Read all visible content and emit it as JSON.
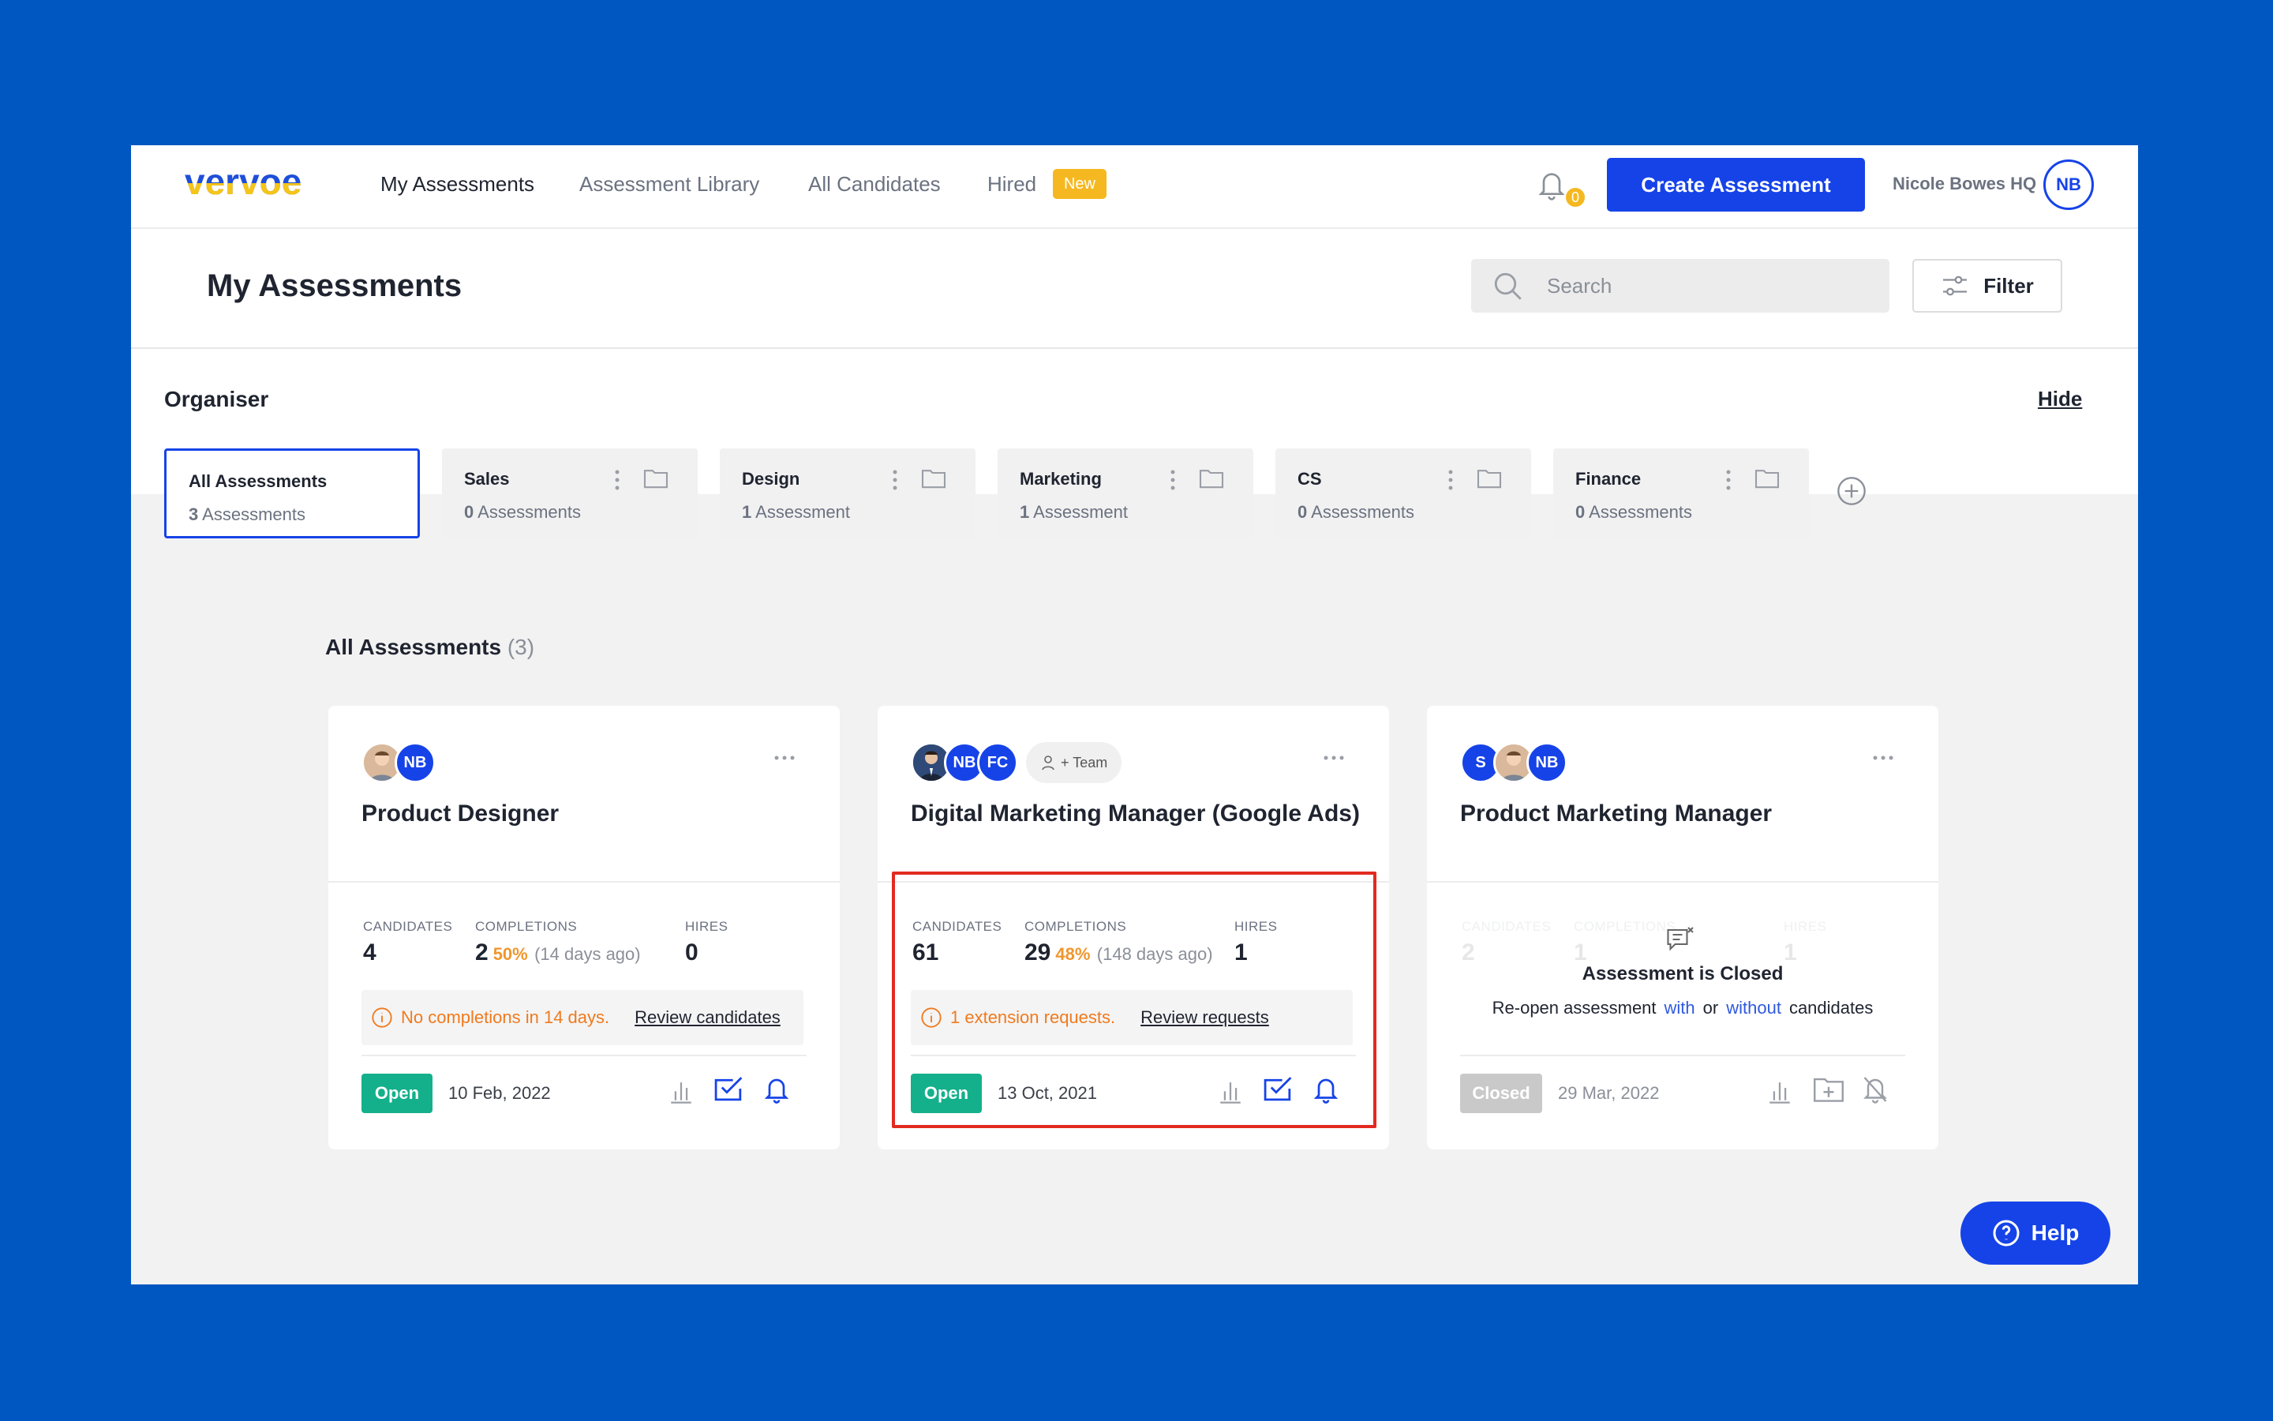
{
  "brand": {
    "logo_text": "vervoe",
    "primary": "#1643e8",
    "accent": "#f5b820",
    "background": "#0057c2"
  },
  "nav": {
    "items": [
      {
        "label": "My Assessments",
        "active": true
      },
      {
        "label": "Assessment Library",
        "active": false
      },
      {
        "label": "All Candidates",
        "active": false
      },
      {
        "label": "Hired",
        "active": false
      }
    ],
    "new_badge": "New",
    "notifications_count": "0",
    "create_button": "Create Assessment",
    "org_name": "Nicole Bowes HQ",
    "user_initials": "NB"
  },
  "header": {
    "title": "My Assessments",
    "search_placeholder": "Search",
    "filter_label": "Filter"
  },
  "organiser": {
    "title": "Organiser",
    "hide_label": "Hide",
    "folders": [
      {
        "name": "All Assessments",
        "count_num": "3",
        "count_label": "Assessments",
        "active": true
      },
      {
        "name": "Sales",
        "count_num": "0",
        "count_label": "Assessments"
      },
      {
        "name": "Design",
        "count_num": "1",
        "count_label": "Assessment"
      },
      {
        "name": "Marketing",
        "count_num": "1",
        "count_label": "Assessment"
      },
      {
        "name": "CS",
        "count_num": "0",
        "count_label": "Assessments"
      },
      {
        "name": "Finance",
        "count_num": "0",
        "count_label": "Assessments"
      }
    ]
  },
  "list": {
    "title": "All Assessments",
    "count": "(3)"
  },
  "labels": {
    "candidates": "CANDIDATES",
    "completions": "COMPLETIONS",
    "hires": "HIRES"
  },
  "cards": [
    {
      "title": "Product Designer",
      "avatars": [
        "NB"
      ],
      "candidates": "4",
      "completions": "2",
      "completion_pct": "50%",
      "completion_ago": "(14 days ago)",
      "hires": "0",
      "alert_text": "No completions in 14 days.",
      "alert_link": "Review candidates",
      "status": "Open",
      "date": "10 Feb, 2022"
    },
    {
      "title": "Digital Marketing Manager (Google Ads)",
      "avatars": [
        "NB",
        "FC"
      ],
      "team_label": "+ Team",
      "candidates": "61",
      "completions": "29",
      "completion_pct": "48%",
      "completion_ago": "(148 days ago)",
      "hires": "1",
      "alert_text": "1 extension requests.",
      "alert_link": "Review requests",
      "status": "Open",
      "date": "13 Oct, 2021"
    },
    {
      "title": "Product Marketing Manager",
      "avatars": [
        "S",
        "NB"
      ],
      "candidates": "2",
      "completions": "1",
      "hires": "1",
      "closed_title": "Assessment is Closed",
      "reopen_prefix": "Re-open assessment",
      "reopen_with": "with",
      "reopen_or": "or",
      "reopen_without": "without",
      "reopen_suffix": "candidates",
      "status": "Closed",
      "date": "29 Mar, 2022"
    }
  ],
  "help_label": "Help"
}
